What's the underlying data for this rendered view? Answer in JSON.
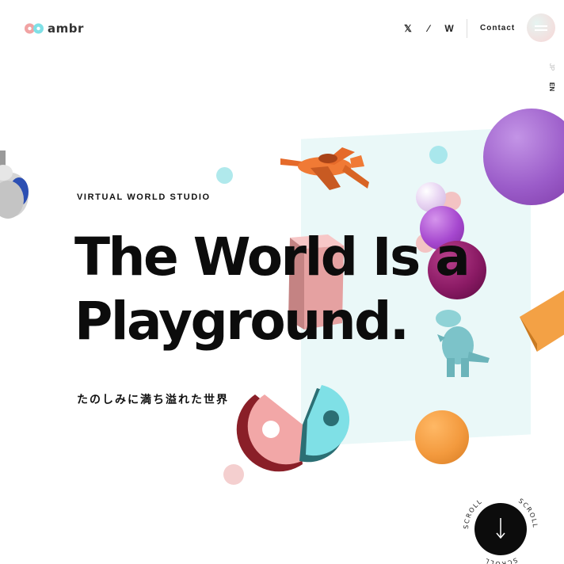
{
  "brand": {
    "name": "ambr",
    "colors": {
      "pink": "#f1a3a3",
      "teal": "#7fe0e6",
      "ink": "#0c0c0c"
    }
  },
  "header": {
    "social": [
      {
        "label": "𝕏",
        "icon": "x-twitter-icon"
      },
      {
        "label": "⁄",
        "icon": "slash-brand-icon"
      },
      {
        "label": "W",
        "icon": "w-brand-icon"
      }
    ],
    "contact_label": "Contact",
    "menu_icon": "hamburger-menu-icon"
  },
  "language": {
    "ja": "JP",
    "en": "EN"
  },
  "hero": {
    "eyebrow": "VIRTUAL WORLD STUDIO",
    "headline_line1": "The World Is a",
    "headline_line2": "Playground.",
    "tagline": "たのしみに満ち溢れた世界"
  },
  "scroll": {
    "label": "SCROLL",
    "icon": "arrow-down-icon"
  }
}
